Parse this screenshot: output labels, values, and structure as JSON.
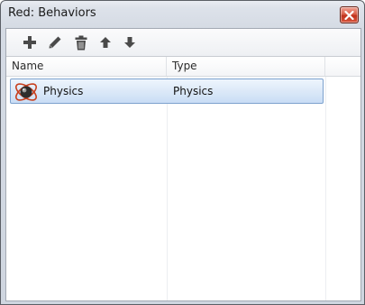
{
  "window": {
    "title": "Red: Behaviors"
  },
  "toolbar": {
    "buttons": [
      {
        "name": "add",
        "icon": "plus-icon"
      },
      {
        "name": "edit",
        "icon": "pencil-icon"
      },
      {
        "name": "delete",
        "icon": "trash-icon"
      },
      {
        "name": "move-up",
        "icon": "arrow-up-icon"
      },
      {
        "name": "move-down",
        "icon": "arrow-down-icon"
      }
    ]
  },
  "list": {
    "columns": [
      "Name",
      "Type"
    ],
    "rows": [
      {
        "name": "Physics",
        "type": "Physics",
        "icon": "physics-icon",
        "selected": true
      }
    ]
  },
  "colors": {
    "selection_border": "#7da2ce",
    "selection_fill": "#dce9f8",
    "close_button": "#c0321c"
  }
}
